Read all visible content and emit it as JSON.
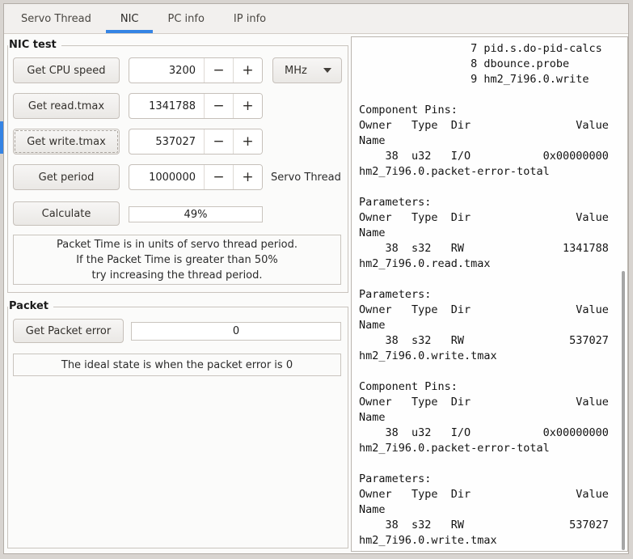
{
  "colors": {
    "accent": "#3584e4"
  },
  "tabs": {
    "servo_thread": "Servo Thread",
    "nic": "NIC",
    "pc_info": "PC info",
    "ip_info": "IP info",
    "active": "NIC"
  },
  "icons": {
    "minus": "−",
    "plus": "+",
    "dropdown": "chevron-down"
  },
  "nic_test": {
    "title": "NIC test",
    "cpu": {
      "button": "Get CPU speed",
      "value": "3200",
      "unit": "MHz"
    },
    "read": {
      "button": "Get read.tmax",
      "value": "1341788"
    },
    "write": {
      "button": "Get write.tmax",
      "value": "537027"
    },
    "period": {
      "button": "Get period",
      "value": "1000000",
      "label": "Servo Thread"
    },
    "calculate_button": "Calculate",
    "packet_time": "49%",
    "note": "Packet Time is in units of servo thread period.\nIf the Packet Time is greater than 50%\ntry increasing the thread period."
  },
  "packet": {
    "title": "Packet",
    "button": "Get Packet error",
    "error_value": "0",
    "note": "The ideal state is when the packet error is 0"
  },
  "output": {
    "lines": [
      "                 7 pid.s.do-pid-calcs",
      "                 8 dbounce.probe",
      "                 9 hm2_7i96.0.write",
      "",
      "Component Pins:",
      "Owner   Type  Dir                Value",
      "Name",
      "    38  u32   I/O           0x00000000",
      "hm2_7i96.0.packet-error-total",
      "",
      "Parameters:",
      "Owner   Type  Dir                Value",
      "Name",
      "    38  s32   RW               1341788",
      "hm2_7i96.0.read.tmax",
      "",
      "Parameters:",
      "Owner   Type  Dir                Value",
      "Name",
      "    38  s32   RW                537027",
      "hm2_7i96.0.write.tmax",
      "",
      "Component Pins:",
      "Owner   Type  Dir                Value",
      "Name",
      "    38  u32   I/O           0x00000000",
      "hm2_7i96.0.packet-error-total",
      "",
      "Parameters:",
      "Owner   Type  Dir                Value",
      "Name",
      "    38  s32   RW                537027",
      "hm2_7i96.0.write.tmax"
    ]
  }
}
